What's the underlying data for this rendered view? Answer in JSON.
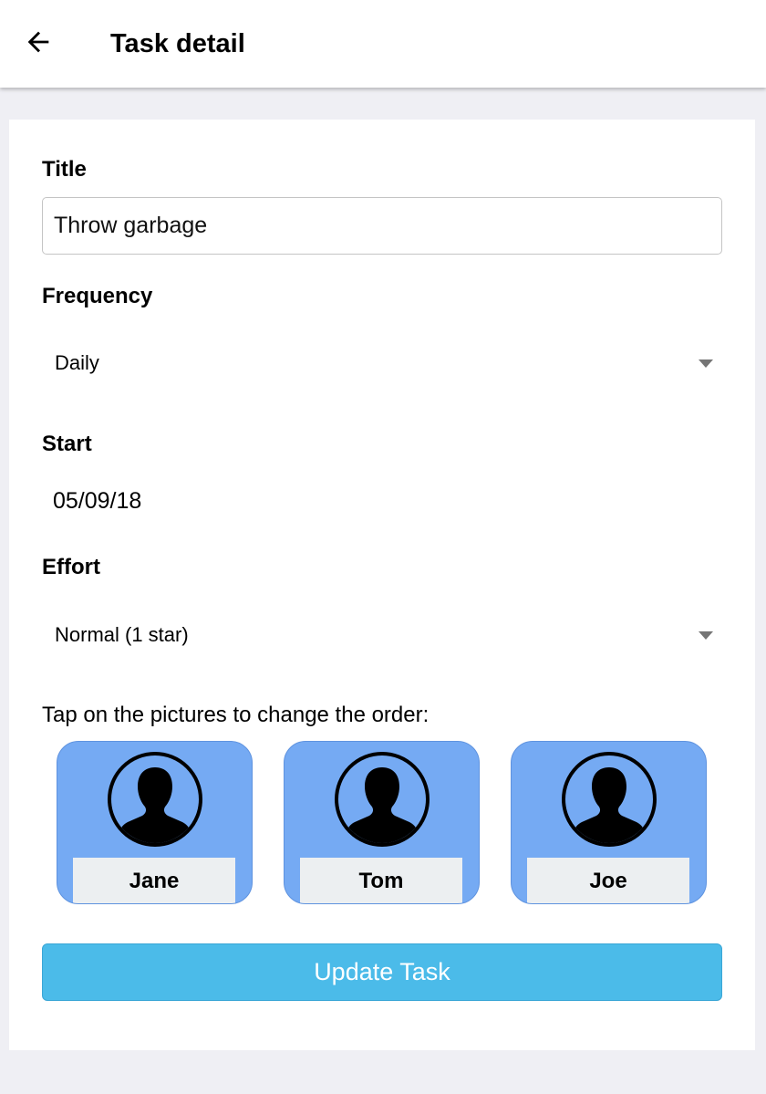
{
  "header": {
    "title": "Task detail",
    "back_icon": "arrow-left-icon"
  },
  "form": {
    "title_label": "Title",
    "title_value": "Throw garbage",
    "frequency_label": "Frequency",
    "frequency_value": "Daily",
    "start_label": "Start",
    "start_value": "05/09/18",
    "effort_label": "Effort",
    "effort_value": "Normal (1 star)",
    "order_hint": "Tap on the pictures to change the order:",
    "submit_label": "Update Task"
  },
  "assignees": [
    {
      "name": "Jane",
      "icon": "user-silhouette-icon"
    },
    {
      "name": "Tom",
      "icon": "user-silhouette-icon"
    },
    {
      "name": "Joe",
      "icon": "user-silhouette-icon"
    }
  ],
  "colors": {
    "tile_background": "#75aaf3",
    "button_background": "#4bbbe9",
    "page_background": "#efeff4"
  }
}
